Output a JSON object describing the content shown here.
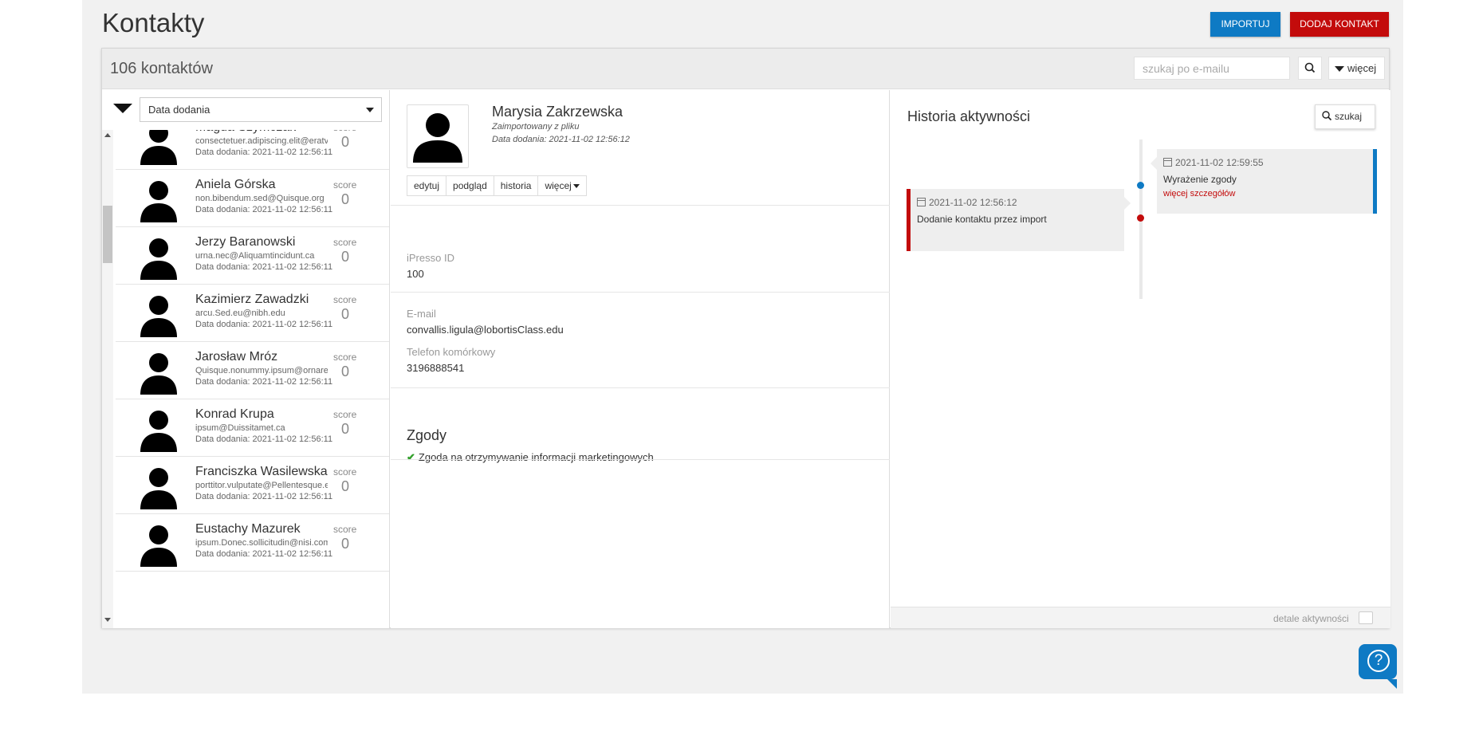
{
  "header": {
    "title": "Kontakty",
    "import_label": "IMPORTUJ",
    "add_label": "DODAJ KONTAKT"
  },
  "toolbar": {
    "count": "106 kontaktów",
    "search_placeholder": "szukaj po e-mailu",
    "more_label": "więcej"
  },
  "list": {
    "sort_value": "Data dodania",
    "score_label": "score",
    "items": [
      {
        "name": "Magda Szymczak",
        "email": "consectetuer.adipiscing.elit@eratvolutpat",
        "date": "Data dodania: 2021-11-02 12:56:11",
        "score": "0"
      },
      {
        "name": "Aniela Górska",
        "email": "non.bibendum.sed@Quisque.org",
        "date": "Data dodania: 2021-11-02 12:56:11",
        "score": "0"
      },
      {
        "name": "Jerzy Baranowski",
        "email": "urna.nec@Aliquamtincidunt.ca",
        "date": "Data dodania: 2021-11-02 12:56:11",
        "score": "0"
      },
      {
        "name": "Kazimierz Zawadzki",
        "email": "arcu.Sed.eu@nibh.edu",
        "date": "Data dodania: 2021-11-02 12:56:11",
        "score": "0"
      },
      {
        "name": "Jarosław Mróz",
        "email": "Quisque.nonummy.ipsum@ornareFusce",
        "date": "Data dodania: 2021-11-02 12:56:11",
        "score": "0"
      },
      {
        "name": "Konrad Krupa",
        "email": "ipsum@Duissitamet.ca",
        "date": "Data dodania: 2021-11-02 12:56:11",
        "score": "0"
      },
      {
        "name": "Franciszka Wasilewska",
        "email": "porttitor.vulputate@Pellentesque.edu",
        "date": "Data dodania: 2021-11-02 12:56:11",
        "score": "0"
      },
      {
        "name": "Eustachy Mazurek",
        "email": "ipsum.Donec.sollicitudin@nisi.com",
        "date": "Data dodania: 2021-11-02 12:56:11",
        "score": "0"
      }
    ]
  },
  "detail": {
    "name": "Marysia Zakrzewska",
    "imported": "Zaimportowany z pliku",
    "added": "Data dodania: 2021-11-02 12:56:12",
    "actions": [
      "edytuj",
      "podgląd",
      "historia",
      "więcej"
    ],
    "ipresso_id_label": "iPresso ID",
    "ipresso_id": "100",
    "email_label": "E-mail",
    "email": "convallis.ligula@lobortisClass.edu",
    "phone_label": "Telefon komórkowy",
    "phone": "3196888541",
    "consents_title": "Zgody",
    "consent_text": "Zgoda na otrzymywanie informacji marketingowych"
  },
  "history": {
    "title": "Historia aktywności",
    "search_label": "szukaj",
    "events": [
      {
        "date": "2021-11-02 12:59:55",
        "text": "Wyrażenie zgody",
        "link": "więcej szczegółów",
        "side": "right",
        "color": "#0e7ac4"
      },
      {
        "date": "2021-11-02 12:56:12",
        "text": "Dodanie kontaktu przez import",
        "side": "left",
        "color": "#c30b0b"
      }
    ],
    "footer_label": "detale aktywności"
  },
  "colors": {
    "primary": "#0e7ac4",
    "danger": "#c30b0b",
    "success": "#33a02c"
  }
}
